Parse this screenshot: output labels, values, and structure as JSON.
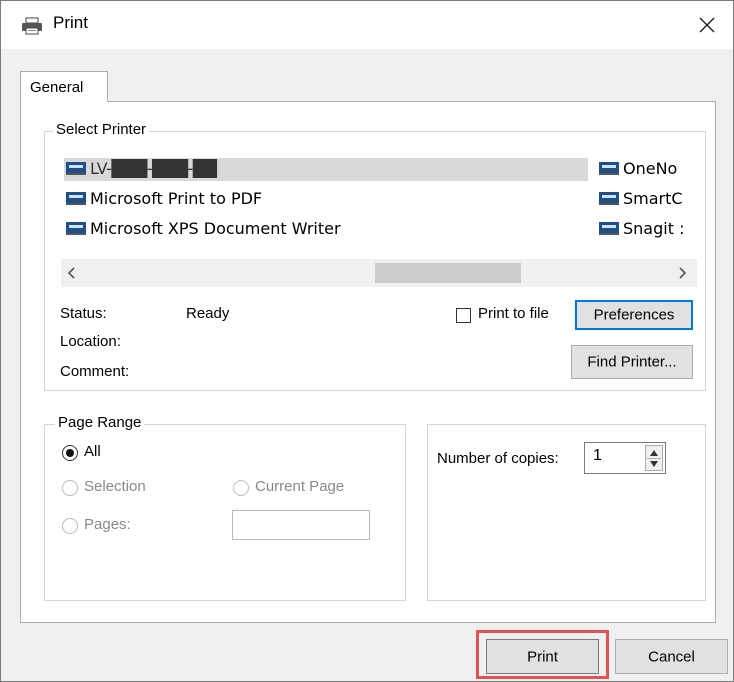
{
  "dialog": {
    "title": "Print",
    "close_icon": "close-icon",
    "title_icon": "printer-icon"
  },
  "tabs": [
    {
      "label": "General"
    }
  ],
  "select_printer": {
    "label": "Select Printer",
    "printers_left": [
      {
        "name": "LV-███-███-██",
        "selected": true
      },
      {
        "name": "Microsoft Print to PDF",
        "selected": false
      },
      {
        "name": "Microsoft XPS Document Writer",
        "selected": false
      }
    ],
    "printers_right": [
      {
        "name": "OneNo"
      },
      {
        "name": "SmartC"
      },
      {
        "name": "Snagit :"
      }
    ],
    "scroll_left_icon": "chevron-left-icon",
    "scroll_right_icon": "chevron-right-icon"
  },
  "status": {
    "status_label": "Status:",
    "status_value": "Ready",
    "location_label": "Location:",
    "comment_label": "Comment:"
  },
  "print_to_file": {
    "label": "Print to file",
    "checked": false
  },
  "buttons": {
    "preferences": "Preferences",
    "find_printer": "Find Printer...",
    "print": "Print",
    "cancel": "Cancel"
  },
  "page_range": {
    "label": "Page Range",
    "all": "All",
    "selection": "Selection",
    "current_page": "Current Page",
    "pages": "Pages:",
    "pages_value": "",
    "selected_option": "All"
  },
  "copies": {
    "label": "Number of copies:",
    "value": "1"
  },
  "colors": {
    "accent": "#0078d7",
    "highlight": "#e05353",
    "selection": "#d9d9d9"
  }
}
